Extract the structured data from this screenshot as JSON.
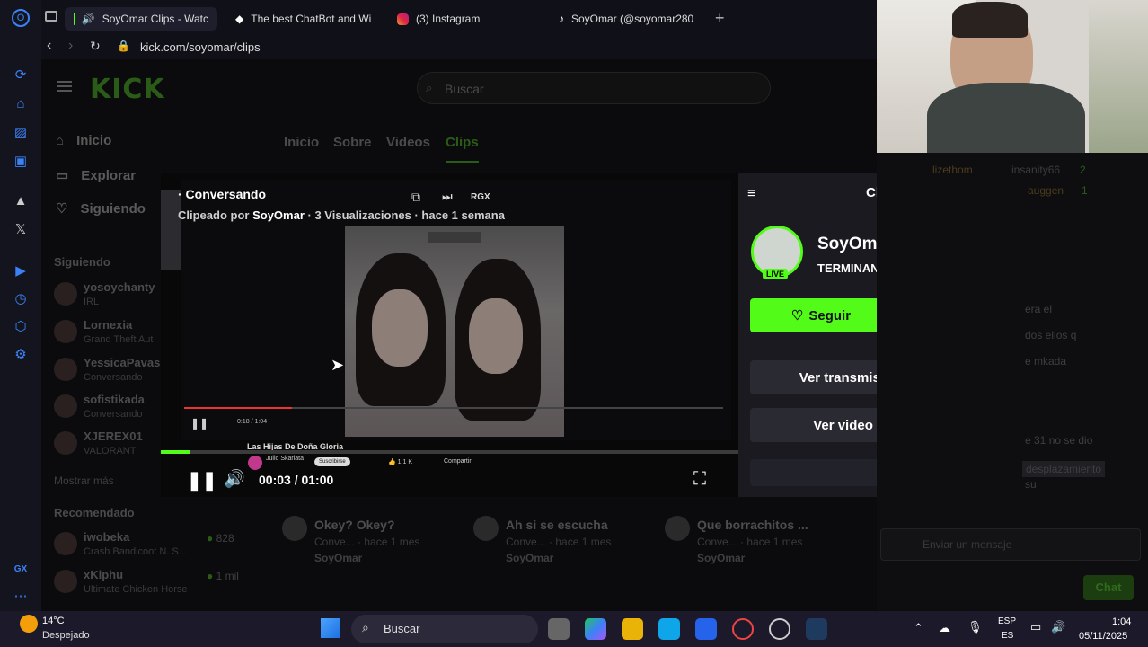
{
  "browser": {
    "tabs": [
      {
        "label": "SoyOmar Clips - Watc",
        "active": true
      },
      {
        "label": "The best ChatBot and Wi",
        "active": false
      },
      {
        "label": "(3) Instagram",
        "active": false
      },
      {
        "label": "SoyOmar (@soyomar280",
        "active": false
      }
    ],
    "new_tab": "+",
    "url": "kick.com/soyomar/clips"
  },
  "kick": {
    "logo": "KICK",
    "search_placeholder": "Buscar",
    "nav": [
      {
        "label": "Inicio"
      },
      {
        "label": "Explorar"
      },
      {
        "label": "Siguiendo"
      }
    ],
    "following_heading": "Siguiendo",
    "following": [
      {
        "name": "yosoychanty",
        "game": "IRL"
      },
      {
        "name": "Lornexia",
        "game": "Grand Theft Aut"
      },
      {
        "name": "YessicaPavas",
        "game": "Conversando"
      },
      {
        "name": "sofistikada",
        "game": "Conversando"
      },
      {
        "name": "XJEREX01",
        "game": "VALORANT"
      }
    ],
    "show_more": "Mostrar más",
    "recommended_heading": "Recomendado",
    "recommended": [
      {
        "name": "iwobeka",
        "game": "Crash Bandicoot N. S...",
        "viewers": "828"
      },
      {
        "name": "xKiphu",
        "game": "Ultimate Chicken Horse",
        "viewers": "1 mil"
      }
    ],
    "channel_tabs": [
      {
        "label": "Inicio"
      },
      {
        "label": "Sobre"
      },
      {
        "label": "Videos"
      },
      {
        "label": "Clips"
      }
    ],
    "clips": [
      {
        "title": "Okey? Okey?",
        "meta": "Conve... · hace 1 mes",
        "user": "SoyOmar"
      },
      {
        "title": "Ah si se escucha",
        "meta": "Conve... · hace 1 mes",
        "user": "SoyOmar"
      },
      {
        "title": "Que borrachitos ...",
        "meta": "Conve... · hace 1 mes",
        "user": "SoyOmar"
      }
    ]
  },
  "player": {
    "title": "· Conversando",
    "clipped_by_prefix": "Clipeado por",
    "clipper": "SoyOmar",
    "stats": "· 3 Visualizaciones · hace 1 semana",
    "time": "00:03 / 01:00",
    "progress": 0.05,
    "inner_time": "0:18 / 1:04",
    "inner_video_title": "Las Hijas De Doña Gloria",
    "inner_channel": "Julio Skarlata",
    "inner_subscribe": "Suscribirse",
    "inner_likes": "1.1 K",
    "inner_share": "Compartir",
    "rgx": "RGX"
  },
  "chat_panel": {
    "title": "Chat",
    "streamer": "SoyOmar",
    "stream_title": "TERMINANDO SEMANITA ! ...",
    "live_badge": "LIVE",
    "follow_label": "Seguir",
    "watch_live": "Ver transmisión en vivo",
    "watch_full": "Ver video completo"
  },
  "background_chat": {
    "names": [
      "lizethom",
      "insanity66",
      "2",
      "auggen",
      "1"
    ],
    "lines": [
      "era el",
      "dos ellos q",
      "e mkada",
      "e 31 no se dio",
      "desplazamiento",
      "su"
    ],
    "send_placeholder": "Enviar un mensaje",
    "chat_button": "Chat"
  },
  "taskbar": {
    "temp": "14°C",
    "weather": "Despejado",
    "search": "Buscar",
    "lang1": "ESP",
    "lang2": "ES",
    "time": "1:04",
    "date": "05/11/2025"
  },
  "colors": {
    "accent": "#53fc18",
    "dark_accent": "#2a5c17",
    "bg": "#0b0b0e"
  }
}
